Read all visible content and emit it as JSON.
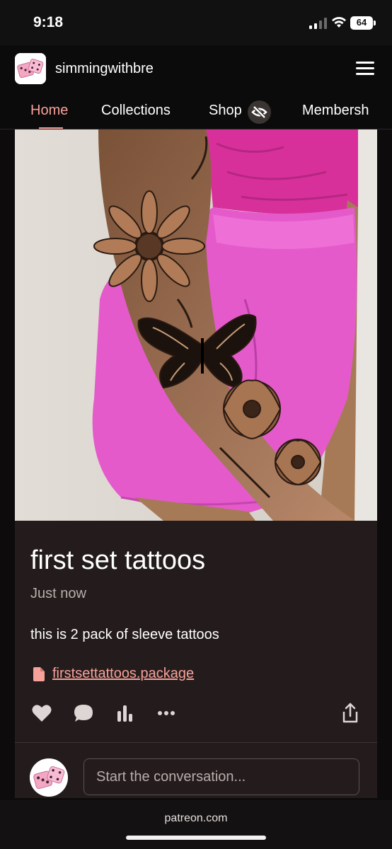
{
  "status_bar": {
    "time": "9:18",
    "battery": "64"
  },
  "header": {
    "creator_name": "simmingwithbre",
    "tabs": [
      {
        "label": "Home",
        "active": true
      },
      {
        "label": "Collections"
      },
      {
        "label": "Shop"
      },
      {
        "label": "Membersh"
      }
    ]
  },
  "post": {
    "title": "first set tattoos",
    "time": "Just now",
    "description": "this is 2 pack of sleeve tattoos",
    "attachment": "firstsettattoos.package",
    "comment_placeholder": "Start the conversation..."
  },
  "browser": {
    "url": "patreon.com"
  },
  "colors": {
    "accent": "#f7a19a",
    "card_bg": "#241c1c",
    "background": "#0d0b0b"
  }
}
